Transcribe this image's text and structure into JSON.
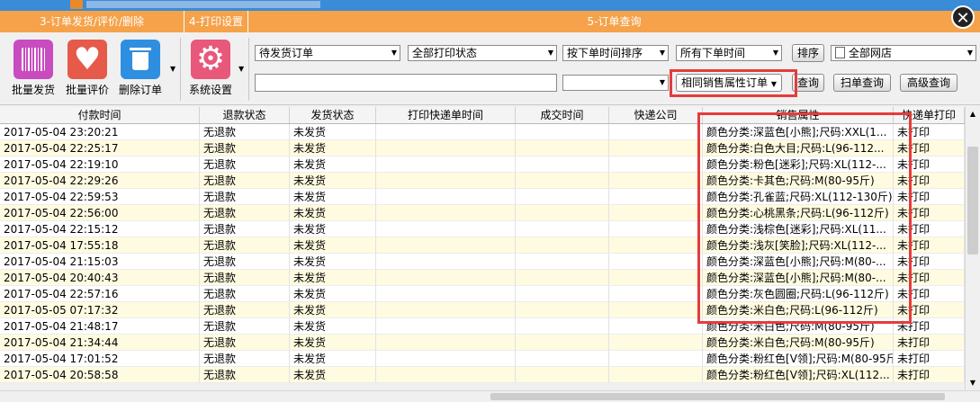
{
  "sections": {
    "s3": "3-订单发货/评价/删除",
    "s4": "4-打印设置",
    "s5": "5-订单查询"
  },
  "toolbar": {
    "batch_ship": "批量发货",
    "batch_review": "批量评价",
    "delete_order": "删除订单",
    "system_settings": "系统设置"
  },
  "filters": {
    "ship_status": "待发货订单",
    "print_status": "全部打印状态",
    "sort": "按下单时间排序",
    "time_range": "所有下单时间",
    "sort_button": "排序",
    "shop": "全部网店",
    "search_text": "",
    "second_combo": "",
    "same_attr": "相同销售属性订单",
    "query_button": "查询",
    "scan_query_button": "扫单查询",
    "advanced_query_button": "高级查询"
  },
  "columns": [
    "付款时间",
    "退款状态",
    "发货状态",
    "打印快递单时间",
    "成交时间",
    "快递公司",
    "销售属性",
    "快递单打印"
  ],
  "rows": [
    [
      "2017-05-04 23:20:21",
      "无退款",
      "未发货",
      "",
      "",
      "",
      "颜色分类:深蓝色[小熊];尺码:XXL(1...",
      "未打印"
    ],
    [
      "2017-05-04 22:25:17",
      "无退款",
      "未发货",
      "",
      "",
      "",
      "颜色分类:白色大目;尺码:L(96-112...",
      "未打印"
    ],
    [
      "2017-05-04 22:19:10",
      "无退款",
      "未发货",
      "",
      "",
      "",
      "颜色分类:粉色[迷彩];尺码:XL(112-...",
      "未打印"
    ],
    [
      "2017-05-04 22:29:26",
      "无退款",
      "未发货",
      "",
      "",
      "",
      "颜色分类:卡其色;尺码:M(80-95斤)",
      "未打印"
    ],
    [
      "2017-05-04 22:59:53",
      "无退款",
      "未发货",
      "",
      "",
      "",
      "颜色分类:孔雀蓝;尺码:XL(112-130斤)",
      "未打印"
    ],
    [
      "2017-05-04 22:56:00",
      "无退款",
      "未发货",
      "",
      "",
      "",
      "颜色分类:心桃黑条;尺码:L(96-112斤)",
      "未打印"
    ],
    [
      "2017-05-04 22:15:12",
      "无退款",
      "未发货",
      "",
      "",
      "",
      "颜色分类:浅棕色[迷彩];尺码:XL(11...",
      "未打印"
    ],
    [
      "2017-05-04 17:55:18",
      "无退款",
      "未发货",
      "",
      "",
      "",
      "颜色分类:浅灰[笑脸];尺码:XL(112-...",
      "未打印"
    ],
    [
      "2017-05-04 21:15:03",
      "无退款",
      "未发货",
      "",
      "",
      "",
      "颜色分类:深蓝色[小熊];尺码:M(80-...",
      "未打印"
    ],
    [
      "2017-05-04 20:40:43",
      "无退款",
      "未发货",
      "",
      "",
      "",
      "颜色分类:深蓝色[小熊];尺码:M(80-...",
      "未打印"
    ],
    [
      "2017-05-04 22:57:16",
      "无退款",
      "未发货",
      "",
      "",
      "",
      "颜色分类:灰色圆圈;尺码:L(96-112斤)",
      "未打印"
    ],
    [
      "2017-05-05 07:17:32",
      "无退款",
      "未发货",
      "",
      "",
      "",
      "颜色分类:米白色;尺码:L(96-112斤)",
      "未打印"
    ],
    [
      "2017-05-04 21:48:17",
      "无退款",
      "未发货",
      "",
      "",
      "",
      "颜色分类:米白色;尺码:M(80-95斤)",
      "未打印"
    ],
    [
      "2017-05-04 21:34:44",
      "无退款",
      "未发货",
      "",
      "",
      "",
      "颜色分类:米白色;尺码:M(80-95斤)",
      "未打印"
    ],
    [
      "2017-05-04 17:01:52",
      "无退款",
      "未发货",
      "",
      "",
      "",
      "颜色分类:粉红色[V领];尺码:M(80-95斤)",
      "未打印"
    ],
    [
      "2017-05-04 20:58:58",
      "无退款",
      "未发货",
      "",
      "",
      "",
      "颜色分类:粉红色[V领];尺码:XL(112...",
      "未打印"
    ]
  ],
  "colors": {
    "section_bar": "#f5a24a",
    "highlight": "#e53c3c",
    "row_alt": "#fffbe0"
  }
}
